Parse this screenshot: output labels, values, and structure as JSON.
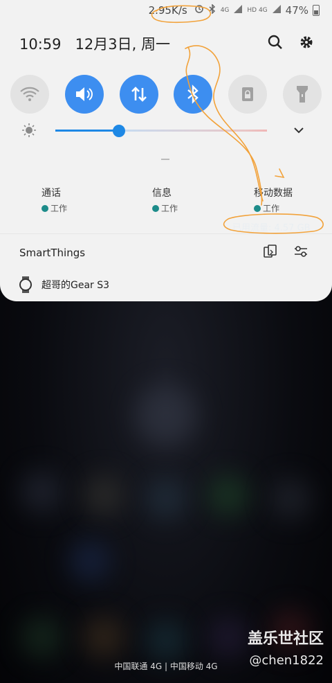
{
  "status_bar": {
    "net_speed": "2.95K/s",
    "sim1_label": "4G",
    "sim2_label": "HD 4G",
    "battery": "47%"
  },
  "header": {
    "time": "10:59",
    "date": "12月3日, 周一"
  },
  "quick_tiles": [
    {
      "name": "wifi",
      "state": "off"
    },
    {
      "name": "sound",
      "state": "on"
    },
    {
      "name": "mobile-data",
      "state": "on"
    },
    {
      "name": "bluetooth",
      "state": "on"
    },
    {
      "name": "lock",
      "state": "off"
    },
    {
      "name": "flashlight",
      "state": "off"
    }
  ],
  "brightness": {
    "level": 0.3
  },
  "apps": [
    {
      "name": "通话",
      "badge": "工作"
    },
    {
      "name": "信息",
      "badge": "工作"
    },
    {
      "name": "移动数据",
      "badge": "工作"
    }
  ],
  "data_usage": "已用流量: 4.57 GB",
  "smartthings": {
    "label": "SmartThings"
  },
  "device": {
    "name": "超哥的Gear S3"
  },
  "bottom": {
    "carrier": "中国联通 4G | 中国移动 4G",
    "watermark_title": "盖乐世社区",
    "watermark_user": "@chen1822"
  }
}
